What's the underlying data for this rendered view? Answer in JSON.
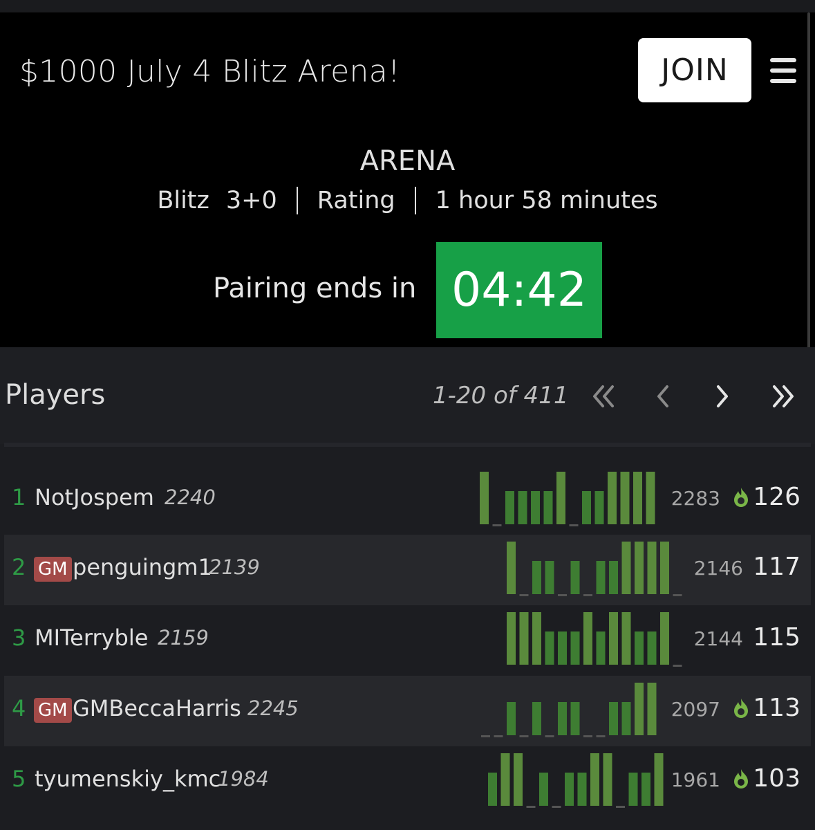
{
  "header": {
    "title": "$1000 July 4 Blitz Arena!",
    "join_label": "JOIN",
    "type": "ARENA",
    "variant": "Blitz",
    "time_control": "3+0",
    "mode": "Rating",
    "duration": "1 hour 58 minutes",
    "pairing_label": "Pairing ends in",
    "clock": "04:42"
  },
  "players": {
    "title": "Players",
    "pager": "1-20 of 411",
    "nav_icons": [
      "double-chevron-left-icon",
      "chevron-left-icon",
      "chevron-right-icon",
      "double-chevron-right-icon"
    ],
    "rows": [
      {
        "rank": "1",
        "title": "",
        "name": "NotJospem",
        "rating": "2240",
        "performance": "2283",
        "fire": true,
        "score": "126",
        "results": [
          2,
          0,
          1,
          1,
          1,
          1,
          2,
          0,
          1,
          1,
          2,
          2,
          2,
          2
        ]
      },
      {
        "rank": "2",
        "title": "GM",
        "name": "penguingm1",
        "rating": "2139",
        "performance": "2146",
        "fire": false,
        "score": "117",
        "results": [
          2,
          0,
          1,
          1,
          0,
          1,
          0,
          1,
          1,
          2,
          2,
          2,
          2,
          0
        ]
      },
      {
        "rank": "3",
        "title": "",
        "name": "MITerryble",
        "rating": "2159",
        "performance": "2144",
        "fire": false,
        "score": "115",
        "results": [
          2,
          2,
          2,
          1,
          1,
          1,
          2,
          1,
          2,
          2,
          1,
          1,
          2,
          0
        ]
      },
      {
        "rank": "4",
        "title": "GM",
        "name": "GMBeccaHarris",
        "rating": "2245",
        "performance": "2097",
        "fire": true,
        "score": "113",
        "results": [
          0,
          0,
          1,
          0,
          1,
          0,
          1,
          1,
          0,
          0,
          1,
          1,
          2,
          2
        ]
      },
      {
        "rank": "5",
        "title": "",
        "name": "tyumenskiy_kmc",
        "rating": "1984",
        "performance": "1961",
        "fire": true,
        "score": "103",
        "results": [
          1,
          2,
          2,
          0,
          1,
          0,
          1,
          1,
          2,
          2,
          0,
          1,
          1,
          2
        ]
      }
    ]
  },
  "colors": {
    "accent_green": "#17a047",
    "rank_green": "#2e9b46",
    "win_bar": "#3e7d32",
    "streak_bar": "#5a8a3c",
    "gm_badge": "#a34a48",
    "fire": "#7ab648"
  }
}
